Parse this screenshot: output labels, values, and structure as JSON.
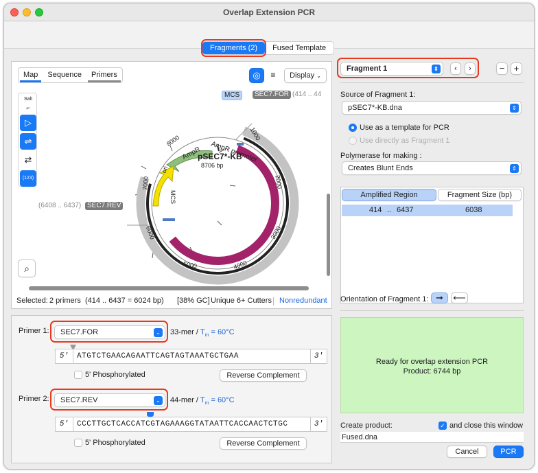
{
  "window": {
    "title": "Overlap Extension PCR"
  },
  "mode_tabs": [
    {
      "label": "Fragments (2)",
      "active": true
    },
    {
      "label": "Fused Template",
      "active": false
    }
  ],
  "view_tabs": [
    {
      "label": "Map",
      "active": true
    },
    {
      "label": "Sequence",
      "active": false
    },
    {
      "label": "Primers",
      "active": false
    }
  ],
  "display_label": "Display",
  "sall_label": "SalI",
  "numbers_tool_label": "(123)",
  "map": {
    "name": "pSEC7*-KB",
    "size": "8706 bp",
    "ticks": [
      "1000",
      "2000",
      "3000",
      "4000",
      "5000",
      "6000",
      "7000",
      "8000"
    ],
    "features": {
      "sec7": "SEC7",
      "ampr": "AmpR",
      "ampr_promoter": "AmpR promoter",
      "ori": "ori",
      "mcs": "MCS"
    },
    "labels": {
      "mcs_top": "MCS",
      "primer_for": "SEC7.FOR",
      "primer_for_range": "(414 .. 44",
      "primer_rev": "SEC7.REV",
      "primer_rev_range": "(6408 .. 6437)"
    }
  },
  "status": {
    "selected_label": "Selected:",
    "selected_value": "2 primers",
    "range": "(414 .. 6437  =  6024 bp)",
    "gc": "[38% GC]",
    "cutters": "Unique 6+ Cutters",
    "link": "Nonredundant"
  },
  "primer1": {
    "label": "Primer 1:",
    "name": "SEC7.FOR",
    "mer": "33-mer",
    "tm_prefix": "T",
    "tm_sub": "m",
    "tm_value": " = 60°C",
    "five": "5'",
    "three": "3'",
    "sequence": "ATGTCTGAACAGAATTCAGTAGTAAATGCTGAA",
    "phos_label": "5' Phosphorylated",
    "rc_label": "Reverse Complement"
  },
  "primer2": {
    "label": "Primer 2:",
    "name": "SEC7.REV",
    "mer": "44-mer",
    "tm_prefix": "T",
    "tm_sub": "m",
    "tm_value": " = 60°C",
    "five": "5'",
    "three": "3'",
    "sequence": "CCCTTGCTCACCATCGTAGAAAGGTATAATTCACCAACTCTGC",
    "phos_label": "5' Phosphorylated",
    "rc_label": "Reverse Complement"
  },
  "fragment": {
    "selector": "Fragment 1",
    "source_label": "Source of Fragment 1:",
    "source_value": "pSEC7*-KB.dna",
    "opt_template": "Use as a template for PCR",
    "opt_direct": "Use directly as Fragment 1",
    "poly_label": "Polymerase for making :",
    "poly_value": "Creates Blunt Ends",
    "col_amplified": "Amplified Region",
    "col_size": "Fragment Size (bp)",
    "row": {
      "start": "414",
      "sep": "..",
      "end": "6437",
      "size": "6038"
    },
    "orientation_label": "Orientation of Fragment 1:"
  },
  "result": {
    "line1": "Ready for overlap extension PCR",
    "line2": "Product:  6744 bp"
  },
  "create": {
    "label": "Create product:",
    "close_label": "and close this window",
    "filename": "Fused.dna",
    "cancel": "Cancel",
    "pcr": "PCR"
  },
  "colors": {
    "accent": "#1a79f5",
    "sec7": "#a3236b",
    "ampr": "#8fbf7d",
    "ori": "#f5e100",
    "result_bg": "#ccf5c0",
    "highlight": "#e8391f"
  }
}
